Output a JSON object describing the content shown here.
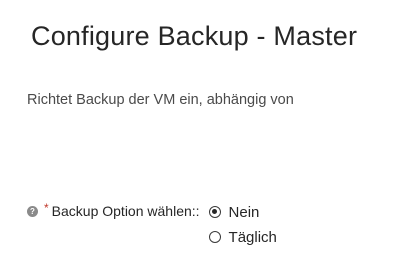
{
  "dialog": {
    "title": "Configure Backup - Master",
    "description": "Richtet Backup der VM ein, abhängig von"
  },
  "backup_option": {
    "label": "Backup Option wählen::",
    "required_mark": "*",
    "help_icon": "help-circle-icon",
    "options": [
      {
        "label": "Nein",
        "selected": true
      },
      {
        "label": "Täglich",
        "selected": false
      }
    ]
  }
}
